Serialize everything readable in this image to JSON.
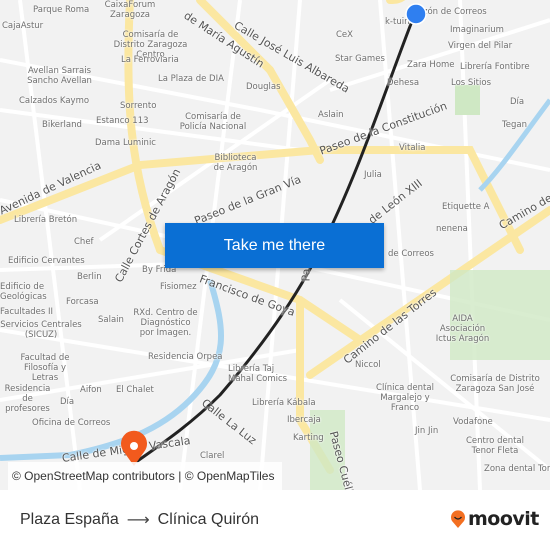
{
  "map": {
    "streets": [
      "Calle José Luis Albareda",
      "de María Agustín",
      "Paseo de la Constitución",
      "Paseo de la Gran Vía",
      "Avenida de Valencia",
      "Calle Cortes de Aragón",
      "Francisco de Goya",
      "de León XIII",
      "Camino de las Torres",
      "Camino de",
      "Calle de Miguel Vascala",
      "Calle La Luz",
      "Paseo Cuéllar",
      "Pasta"
    ],
    "pois": [
      "Parque Roma",
      "CaixaForum Zaragoza",
      "CajaAstur",
      "Comisaría de Distrito Zaragoza Centro",
      "La Ferroviaria",
      "Avellan Sarrais Sancho Avellan",
      "La Plaza de DIA",
      "Douglas",
      "Calzados Kaymo",
      "Sorrento",
      "Estanco 113",
      "Bikerland",
      "Comisaría de Policía Nacional",
      "Dama Luminic",
      "Biblioteca de Aragón",
      "Librería Bretón",
      "Chef",
      "zón de Correos",
      "k-tuin",
      "Imaginarium",
      "CeX",
      "Virgen del Pilar",
      "Star Games",
      "Zara Home",
      "Librería Fontibre",
      "Dehesa",
      "Los Sitios",
      "Día",
      "Aslain",
      "Tegan",
      "Vitalia",
      "Julia",
      "Etiquette A",
      "nenena",
      "Edificio Cervantes",
      "Berlin",
      "By Frida",
      "Fisiomez",
      "Forcasa",
      "Salain",
      "RXd. Centro de Diagnóstico por Imagen.",
      "Servicios Centrales (SICUZ)",
      "Facultad de Filosofía y Letras",
      "Residencia Orpea",
      "Librería Taj Mahal Comics",
      "Residencia de profesores",
      "Aifon",
      "El Chalet",
      "Día",
      "Oficina de Correos",
      "Librería Kábala",
      "Clarel",
      "Ibercaja",
      "Karting",
      "de Correos",
      "AIDA Asociación Ictus Aragón",
      "Niccol",
      "Clínica dental Margalejo y Franco",
      "Comisaría de Distrito Zaragoza San José",
      "Vodafone",
      "Jin Jin",
      "Centro dental Tenor Fleta",
      "Zona dental Tor",
      "Edificio de Geológicas",
      "Facultades II"
    ],
    "route_color": "#222222",
    "origin_color": "#2f7ff0",
    "destination_color": "#f25a1d"
  },
  "cta": {
    "label": "Take me there"
  },
  "attribution": {
    "osm": "© OpenStreetMap contributors",
    "sep": " | ",
    "omt": "© OpenMapTiles"
  },
  "trip": {
    "origin": "Plaza España",
    "arrow": "⟶",
    "destination": "Clínica Quirón"
  },
  "brand": {
    "name": "moovit",
    "color": "#f36f21"
  }
}
